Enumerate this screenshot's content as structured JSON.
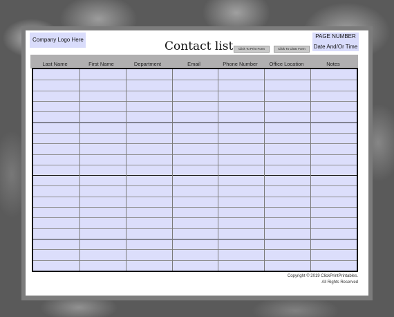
{
  "header": {
    "logo_text": "Company Logo Here",
    "title": "Contact list",
    "print_button": "Click To Print Form",
    "clear_button": "Click To Clear Form",
    "page_number": "PAGE NUMBER",
    "date_time": "Date And/Or Time"
  },
  "table": {
    "columns": [
      "Last Name",
      "First Name",
      "Department",
      "Email",
      "Phone Number",
      "Office Location",
      "Notes"
    ],
    "row_count": 19
  },
  "footer": {
    "copyright_line1": "Copyright © 2019 ClickPrintPrintables.",
    "copyright_line2": "All Rights Reserved"
  },
  "colors": {
    "field_fill": "#dcdefb",
    "header_band": "#b0afb0",
    "frame": "#7c7c7c"
  }
}
